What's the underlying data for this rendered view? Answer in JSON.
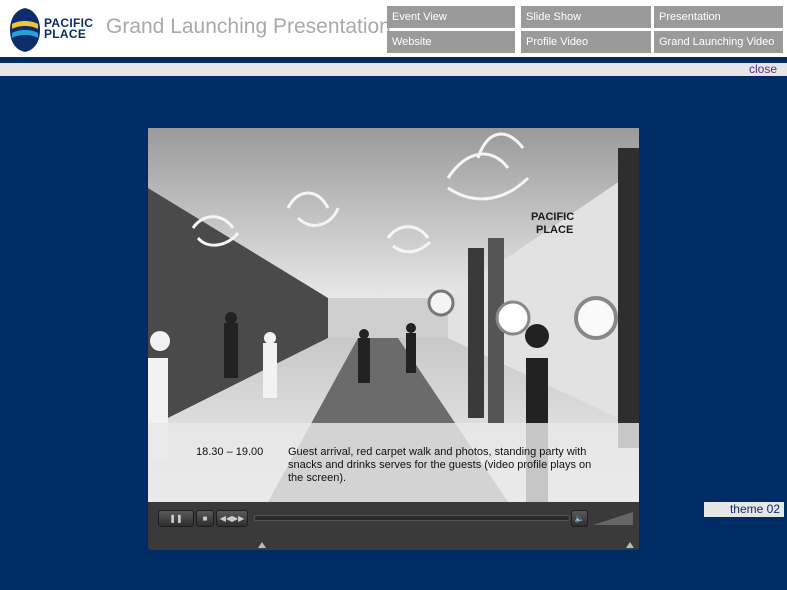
{
  "brand": {
    "line1": "PACIFIC",
    "line2": "PLACE"
  },
  "app_title": "Grand Launching Presentation",
  "nav": {
    "row1": [
      "Event View",
      "Slide Show",
      "Presentation"
    ],
    "row2": [
      "Website",
      "Profile Video",
      "Grand Launching Video"
    ]
  },
  "close_label": "close",
  "scene": {
    "wall_sign_line1": "PACIFIC",
    "wall_sign_line2": "PLACE"
  },
  "caption": {
    "time": "18.30 – 19.00",
    "text": "Guest arrival, red carpet walk and photos, standing party with snacks and drinks serves for the guests (video profile plays on the screen)."
  },
  "controls": {
    "pause": "❚❚",
    "stop": "■",
    "rewind": "◀◀",
    "forward": "▶▶",
    "volume": "🔈"
  },
  "theme_label": "theme 02",
  "icons": {
    "logo": "pacific-place-logo-icon",
    "volume": "speaker-icon"
  },
  "colors": {
    "navy": "#002c66",
    "nav_bg": "#9a9a9a",
    "title_gray": "#a9a9a9",
    "close_text": "#5a2a8a"
  }
}
